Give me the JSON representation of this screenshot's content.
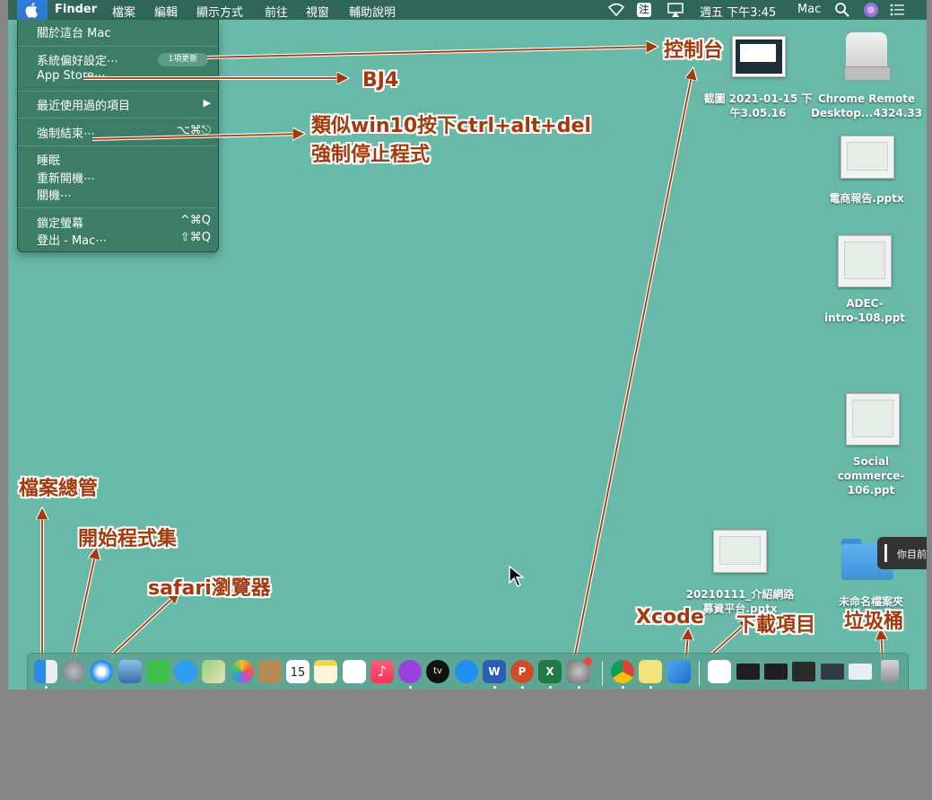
{
  "menubar": {
    "app": "Finder",
    "items": [
      "檔案",
      "編輯",
      "顯示方式",
      "前往",
      "視窗",
      "輔助說明"
    ],
    "clock": "週五 下午3:45",
    "user": "Mac",
    "input_method": "注"
  },
  "apple_menu": {
    "about": "關於這台 Mac",
    "prefs": "系統偏好設定⋯",
    "prefs_badge": "1項更新",
    "appstore": "App Store⋯",
    "recent": "最近使用過的項目",
    "recent_arrow": "▶",
    "force_quit": "強制結束⋯",
    "force_quit_shortcut": "⌥⌘⎋",
    "sleep": "睡眠",
    "restart": "重新開機⋯",
    "shutdown": "關機⋯",
    "lock": "鎖定螢幕",
    "lock_shortcut": "^⌘Q",
    "logout": "登出 - Mac⋯",
    "logout_shortcut": "⇧⌘Q"
  },
  "desktop": {
    "screenshot_label_1": "截圖 2021-01-15 下",
    "screenshot_label_2": "午3.05.16",
    "chrome_label_1": "Chrome Remote",
    "chrome_label_2": "Desktop...4324.33",
    "ecommerce_label": "電商報告.pptx",
    "adec_label_1": "ADEC-",
    "adec_label_2": "intro-108.ppt",
    "social_label_1": "Social",
    "social_label_2": "commerce-106.ppt",
    "fundraising_label_1": "20210111_介紹網路",
    "fundraising_label_2": "募資平台.pptx",
    "folder_label": "未命名檔案夾",
    "tooltip": "你目前"
  },
  "annotations": {
    "control_center": "控制台",
    "bj4": "BJ4",
    "force_quit_line1": "類似win10按下ctrl+alt+del",
    "force_quit_line2": "強制停止程式",
    "finder": "檔案總管",
    "launchpad": "開始程式集",
    "safari": "safari瀏覽器",
    "xcode": "Xcode",
    "downloads": "下載項目",
    "trash": "垃圾桶"
  },
  "dock": {
    "apps": [
      "finder-icon",
      "launchpad-icon",
      "safari-icon",
      "preview-icon",
      "facetime-icon",
      "messages-icon",
      "maps-icon",
      "photos-icon",
      "contacts-icon",
      "calendar-icon",
      "notes-icon",
      "reminders-icon",
      "music-icon",
      "podcasts-icon",
      "tv-icon",
      "appstore-icon",
      "word-icon",
      "powerpoint-icon",
      "excel-icon",
      "system-preferences-icon",
      "chrome-icon",
      "stickies-icon",
      "xcode-icon",
      "document-icon",
      "download-1-icon",
      "download-2-icon",
      "download-3-icon",
      "download-4-icon",
      "download-5-icon",
      "trash-icon"
    ],
    "calendar_day": "15",
    "tv_label": "tv",
    "word_letter": "W",
    "ppt_letter": "P",
    "excel_letter": "X"
  },
  "colors": {
    "desktop": "#68b9a7",
    "menubar": "#2f6657",
    "annotation": "#a33a0e"
  }
}
